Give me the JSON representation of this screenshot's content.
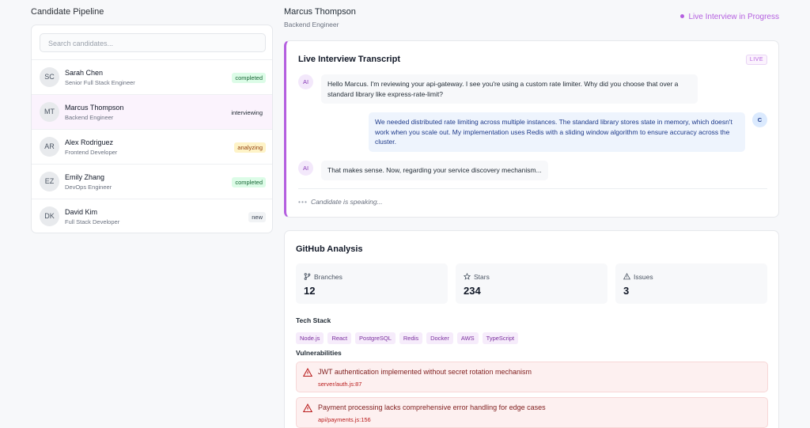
{
  "pipeline": {
    "title": "Candidate Pipeline",
    "search_placeholder": "Search candidates...",
    "candidates": [
      {
        "initials": "SC",
        "name": "Sarah Chen",
        "role": "Senior Full Stack Engineer",
        "status": "completed"
      },
      {
        "initials": "MT",
        "name": "Marcus Thompson",
        "role": "Backend Engineer",
        "status": "interviewing"
      },
      {
        "initials": "AR",
        "name": "Alex Rodriguez",
        "role": "Frontend Developer",
        "status": "analyzing"
      },
      {
        "initials": "EZ",
        "name": "Emily Zhang",
        "role": "DevOps Engineer",
        "status": "completed"
      },
      {
        "initials": "DK",
        "name": "David Kim",
        "role": "Full Stack Developer",
        "status": "new"
      }
    ]
  },
  "header": {
    "candidate_name": "Marcus Thompson",
    "candidate_role": "Backend Engineer",
    "status_text": "Live Interview in Progress"
  },
  "transcript": {
    "title": "Live Interview Transcript",
    "live_tag": "LIVE",
    "messages": [
      {
        "speaker": "AI",
        "text": "Hello Marcus. I'm reviewing your api-gateway. I see you're using a custom rate limiter. Why did you choose that over a standard library like express-rate-limit?"
      },
      {
        "speaker": "C",
        "text": "We needed distributed rate limiting across multiple instances. The standard library stores state in memory, which doesn't work when you scale out. My implementation uses Redis with a sliding window algorithm to ensure accuracy across the cluster."
      },
      {
        "speaker": "AI",
        "text": "That makes sense. Now, regarding your service discovery mechanism..."
      }
    ],
    "speaking_text": "Candidate is speaking..."
  },
  "github": {
    "title": "GitHub Analysis",
    "stats": [
      {
        "label": "Branches",
        "value": "12",
        "icon": "branch-icon"
      },
      {
        "label": "Stars",
        "value": "234",
        "icon": "star-icon"
      },
      {
        "label": "Issues",
        "value": "3",
        "icon": "warning-icon"
      }
    ],
    "tech_stack_label": "Tech Stack",
    "tech_stack": [
      "Node.js",
      "React",
      "PostgreSQL",
      "Redis",
      "Docker",
      "AWS",
      "TypeScript"
    ],
    "vulnerabilities_label": "Vulnerabilities",
    "vulnerabilities": [
      {
        "title": "JWT authentication implemented without secret rotation mechanism",
        "file": "server/auth.js:87"
      },
      {
        "title": "Payment processing lacks comprehensive error handling for edge cases",
        "file": "api/payments.js:156"
      }
    ]
  },
  "colors": {
    "accent": "#b45fdf",
    "danger_bg": "#fdf0f0",
    "danger_text": "#7f1d1d"
  }
}
